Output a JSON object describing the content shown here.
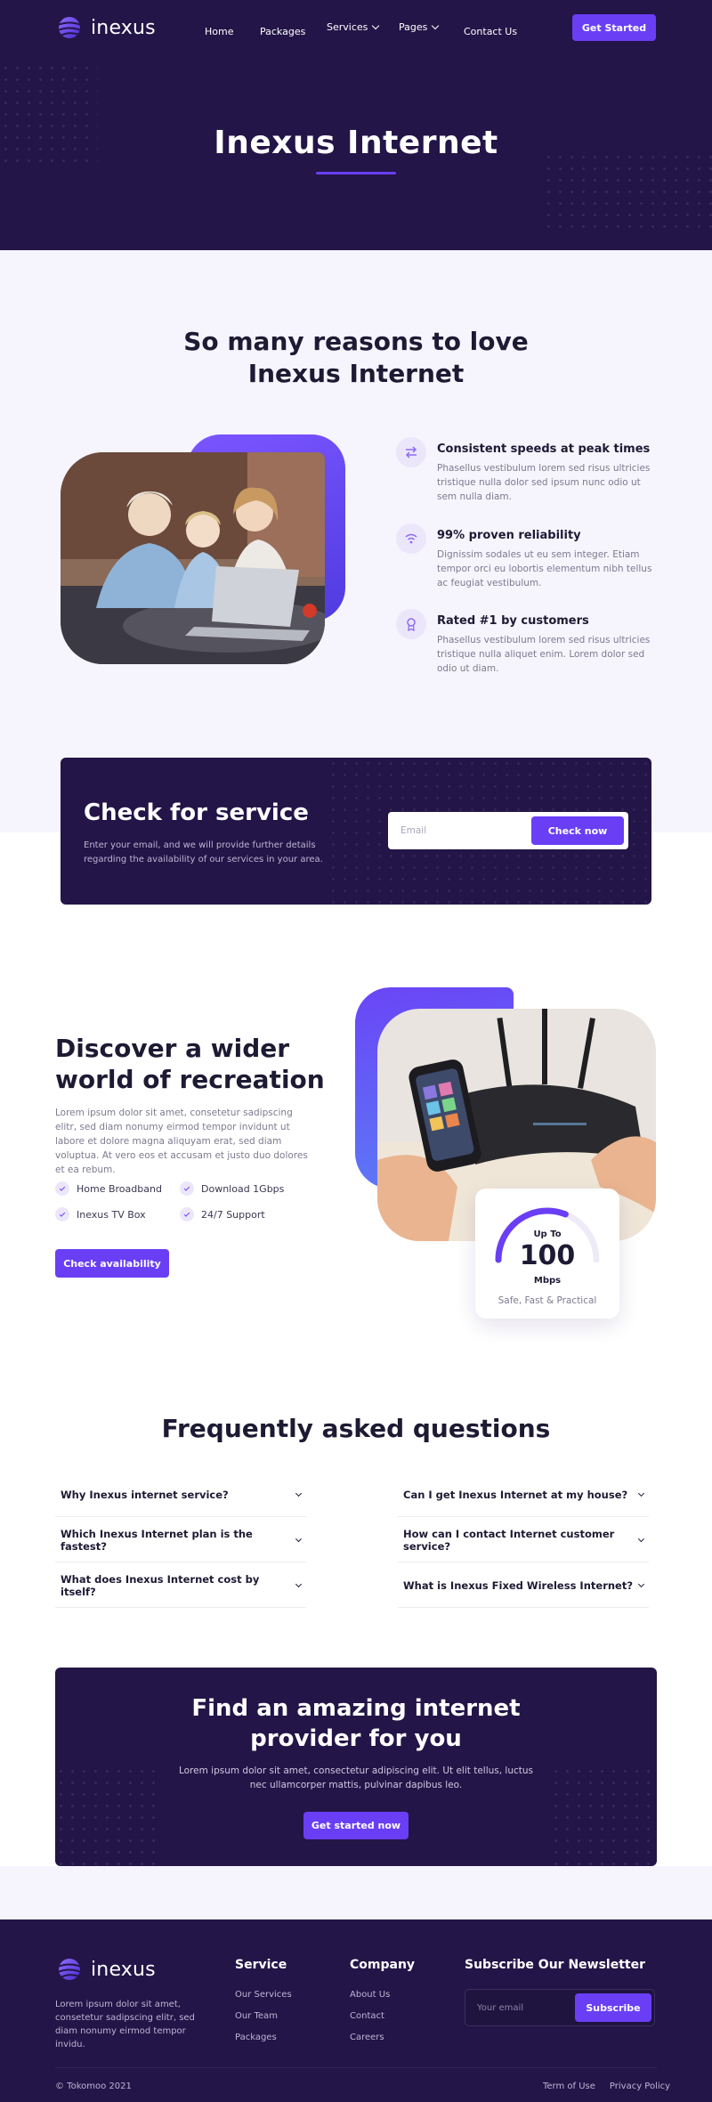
{
  "brand": {
    "name": "inexus",
    "accent": "#6a3ef5",
    "dark": "#231547"
  },
  "nav": {
    "items": [
      {
        "label": "Home"
      },
      {
        "label": "Packages"
      },
      {
        "label": "Services"
      },
      {
        "label": "Pages"
      },
      {
        "label": "Contact Us"
      }
    ],
    "cta": "Get Started"
  },
  "hero": {
    "title": "Inexus Internet"
  },
  "reasons": {
    "title_line1": "So many reasons to love",
    "title_line2": "Inexus Internet",
    "features": [
      {
        "icon": "speed-arrows-icon",
        "title": "Consistent speeds at peak times",
        "text": "Phasellus vestibulum lorem sed risus ultricies tristique nulla dolor sed ipsum nunc odio ut sem nulla diam."
      },
      {
        "icon": "wifi-icon",
        "title": "99% proven reliability",
        "text": "Dignissim sodales ut eu sem integer. Etiam tempor orci eu lobortis elementum nibh tellus ac feugiat vestibulum."
      },
      {
        "icon": "award-icon",
        "title": "Rated #1 by customers",
        "text": "Phasellus vestibulum lorem sed risus ultricies tristique nulla aliquet enim. Lorem dolor sed odio ut diam."
      }
    ]
  },
  "check": {
    "title": "Check for service",
    "text": "Enter your email, and we will provide further details regarding the availability of our services in your area.",
    "placeholder": "Email",
    "button": "Check now"
  },
  "discover": {
    "title_line1": "Discover a wider",
    "title_line2": "world of recreation",
    "text": "Lorem ipsum dolor sit amet, consetetur sadipscing elitr, sed diam nonumy eirmod tempor invidunt ut labore et dolore magna aliquyam erat, sed diam voluptua. At vero eos et accusam et justo duo dolores et ea rebum.",
    "checks": [
      "Home Broadband",
      "Download 1Gbps",
      "Inexus TV Box",
      "24/7 Support"
    ],
    "button": "Check availability",
    "speed": {
      "label_top": "Up To",
      "value": "100",
      "unit": "Mbps",
      "caption": "Safe, Fast & Practical",
      "gauge_fraction": 0.62
    }
  },
  "faq": {
    "title": "Frequently asked questions",
    "left": [
      "Why Inexus internet service?",
      "Which Inexus Internet plan is the fastest?",
      "What does Inexus Internet cost by itself?"
    ],
    "right": [
      "Can I get Inexus Internet at my house?",
      "How can I contact Internet customer service?",
      "What is Inexus Fixed Wireless Internet?"
    ]
  },
  "cta": {
    "title_line1": "Find an amazing internet",
    "title_line2": "provider for you",
    "text": "Lorem ipsum dolor sit amet, consectetur adipiscing elit. Ut elit tellus, luctus nec ullamcorper mattis, pulvinar dapibus leo.",
    "button": "Get started now"
  },
  "footer": {
    "about": "Lorem ipsum dolor sit amet, consetetur sadipscing elitr, sed diam nonumy eirmod tempor invidu.",
    "service": {
      "title": "Service",
      "links": [
        "Our Services",
        "Our Team",
        "Packages"
      ]
    },
    "company": {
      "title": "Company",
      "links": [
        "About Us",
        "Contact",
        "Careers"
      ]
    },
    "newsletter": {
      "title": "Subscribe Our Newsletter",
      "placeholder": "Your email",
      "button": "Subscribe"
    },
    "copyright": "© Tokomoo 2021",
    "legal": [
      "Term of Use",
      "Privacy Policy"
    ]
  }
}
